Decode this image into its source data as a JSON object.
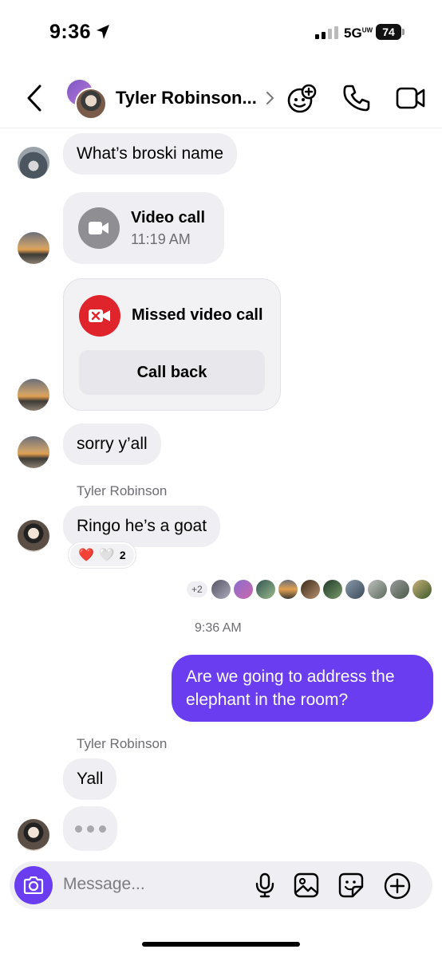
{
  "status_bar": {
    "time": "9:36",
    "network": "5G",
    "network_sup": "UW",
    "battery": "74"
  },
  "header": {
    "title": "Tyler Robinson..."
  },
  "messages": {
    "m1": "What’s broski name",
    "video_call": {
      "title": "Video call",
      "time": "11:19 AM"
    },
    "missed_call": {
      "title": "Missed video call",
      "button": "Call back"
    },
    "m2": "sorry y’all",
    "sender1": "Tyler Robinson",
    "m3": "Ringo he’s a goat",
    "reactions": {
      "emojis": [
        "❤️",
        "🤍"
      ],
      "count": "2"
    },
    "seen_more": "+2",
    "timestamp": "9:36 AM",
    "outgoing": "Are we going to address the elephant in the room?",
    "sender2": "Tyler Robinson",
    "m4": "Yall"
  },
  "composer": {
    "placeholder": "Message..."
  },
  "colors": {
    "accent": "#6a3df0",
    "missed_red": "#e0242b",
    "video_gray": "#8e8e93"
  }
}
